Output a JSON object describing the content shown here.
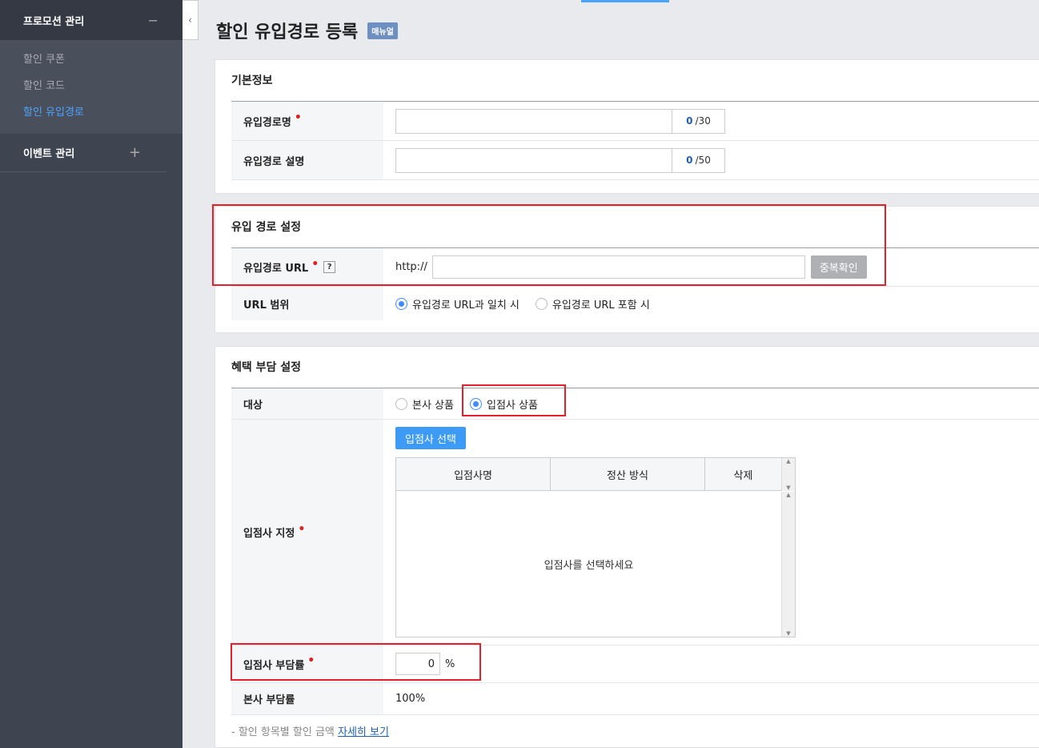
{
  "sidebar": {
    "sections": [
      {
        "label": "프로모션 관리",
        "toggle": "−",
        "items": [
          {
            "label": "할인 쿠폰"
          },
          {
            "label": "할인 코드"
          },
          {
            "label": "할인 유입경로"
          }
        ]
      },
      {
        "label": "이벤트 관리",
        "toggle": "+"
      }
    ],
    "collapse_icon": "‹"
  },
  "page": {
    "title": "할인 유입경로 등록",
    "manual_badge": "매뉴얼"
  },
  "basic_info": {
    "title": "기본정보",
    "name_label": "유입경로명",
    "name_count": "0",
    "name_max": "/30",
    "desc_label": "유입경로 설명",
    "desc_count": "0",
    "desc_max": "/50"
  },
  "path_settings": {
    "title": "유입 경로 설정",
    "url_label": "유입경로 URL",
    "help": "?",
    "url_prefix": "http://",
    "dup_check": "중복확인",
    "scope_label": "URL 범위",
    "scope_options": [
      "유입경로 URL과 일치 시",
      "유입경로 URL 포함 시"
    ],
    "scope_selected": 0
  },
  "benefit": {
    "title": "혜택 부담 설정",
    "target_label": "대상",
    "target_options": [
      "본사 상품",
      "입점사 상품"
    ],
    "target_selected": 1,
    "vendor_label": "입점사 지정",
    "vendor_button": "입점사 선택",
    "grid_headers": [
      "입점사명",
      "정산 방식",
      "삭제"
    ],
    "grid_empty": "입점사를 선택하세요",
    "vendor_rate_label": "입점사 부담률",
    "vendor_rate_value": "0",
    "percent": "%",
    "hq_rate_label": "본사 부담률",
    "hq_rate_value": "100%",
    "note": "- 할인 항목별 할인 금액",
    "note_link": "자세히 보기"
  }
}
